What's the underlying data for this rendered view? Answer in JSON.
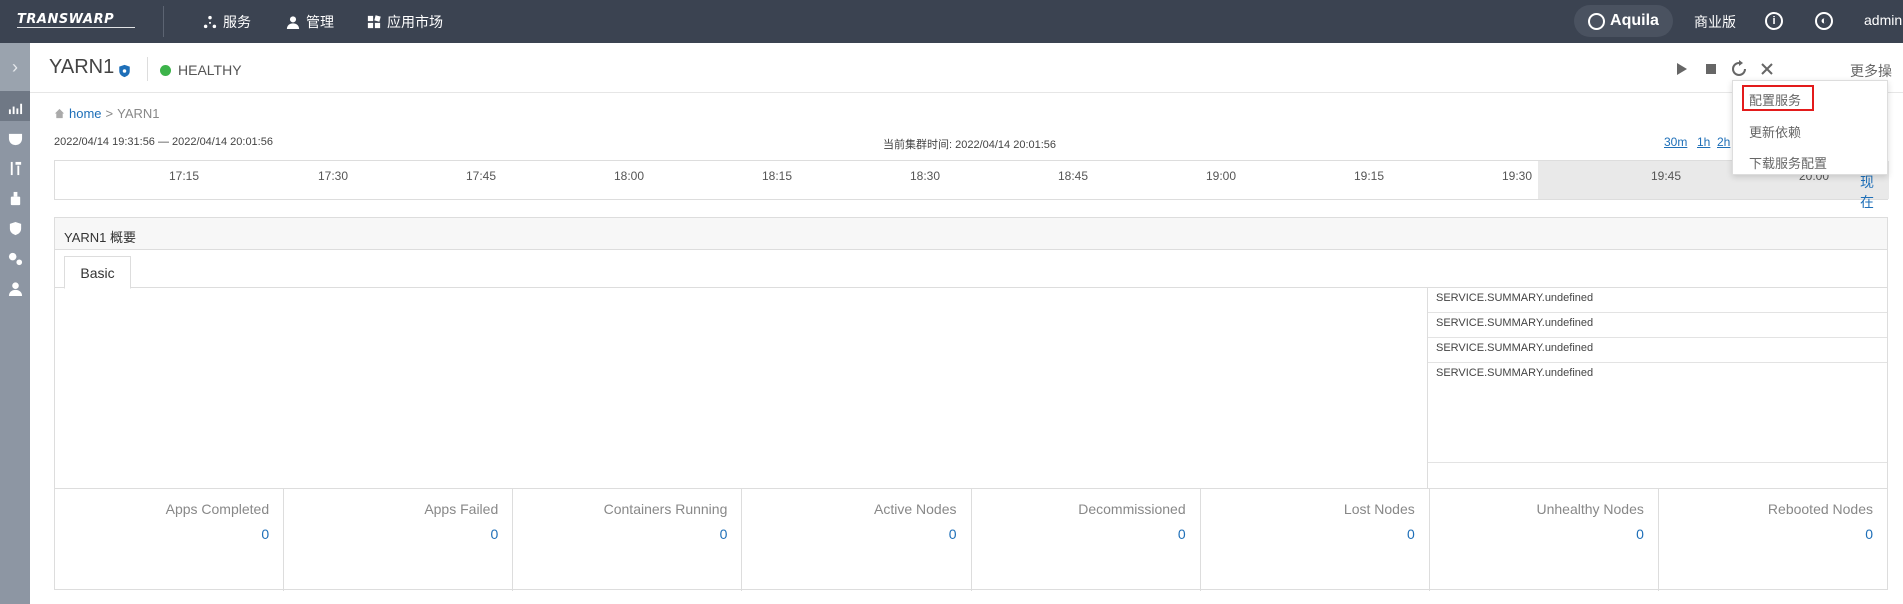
{
  "topbar": {
    "logo": "TRANSWARP",
    "nav": [
      {
        "label": "服务",
        "icon": "services-icon"
      },
      {
        "label": "管理",
        "icon": "user-icon"
      },
      {
        "label": "应用市场",
        "icon": "apps-icon"
      }
    ],
    "aquila": "Aquila",
    "edition": "商业版",
    "user": "admin"
  },
  "header": {
    "service_name": "YARN1",
    "health": "HEALTHY",
    "more_ops": "更多操作"
  },
  "breadcrumb": {
    "home": "home",
    "sep": ">",
    "current": "YARN1"
  },
  "time": {
    "range": "2022/04/14 19:31:56 — 2022/04/14 20:01:56",
    "cluster_time": "当前集群时间: 2022/04/14 20:01:56",
    "buttons": [
      "30m",
      "1h",
      "2h"
    ],
    "ticks": [
      "17:15",
      "17:30",
      "17:45",
      "18:00",
      "18:15",
      "18:30",
      "18:45",
      "19:00",
      "19:15",
      "19:30",
      "19:45",
      "20:00"
    ],
    "now": "现在"
  },
  "overview": {
    "title": "YARN1 概要",
    "tab": "Basic",
    "summary": [
      "SERVICE.SUMMARY.undefined",
      "SERVICE.SUMMARY.undefined",
      "SERVICE.SUMMARY.undefined",
      "SERVICE.SUMMARY.undefined"
    ],
    "metrics": [
      {
        "label": "Apps Completed",
        "value": "0"
      },
      {
        "label": "Apps Failed",
        "value": "0"
      },
      {
        "label": "Containers Running",
        "value": "0"
      },
      {
        "label": "Active Nodes",
        "value": "0"
      },
      {
        "label": "Decommissioned",
        "value": "0"
      },
      {
        "label": "Lost Nodes",
        "value": "0"
      },
      {
        "label": "Unhealthy Nodes",
        "value": "0"
      },
      {
        "label": "Rebooted Nodes",
        "value": "0"
      }
    ]
  },
  "dropdown": {
    "items": [
      "配置服务",
      "更新依赖",
      "下载服务配置"
    ]
  },
  "colors": {
    "topbar": "#3b4351",
    "sidebar": "#8d96a3",
    "healthy": "#3cb34a",
    "link": "#1e6fb8",
    "highlight": "#e31b1b"
  }
}
